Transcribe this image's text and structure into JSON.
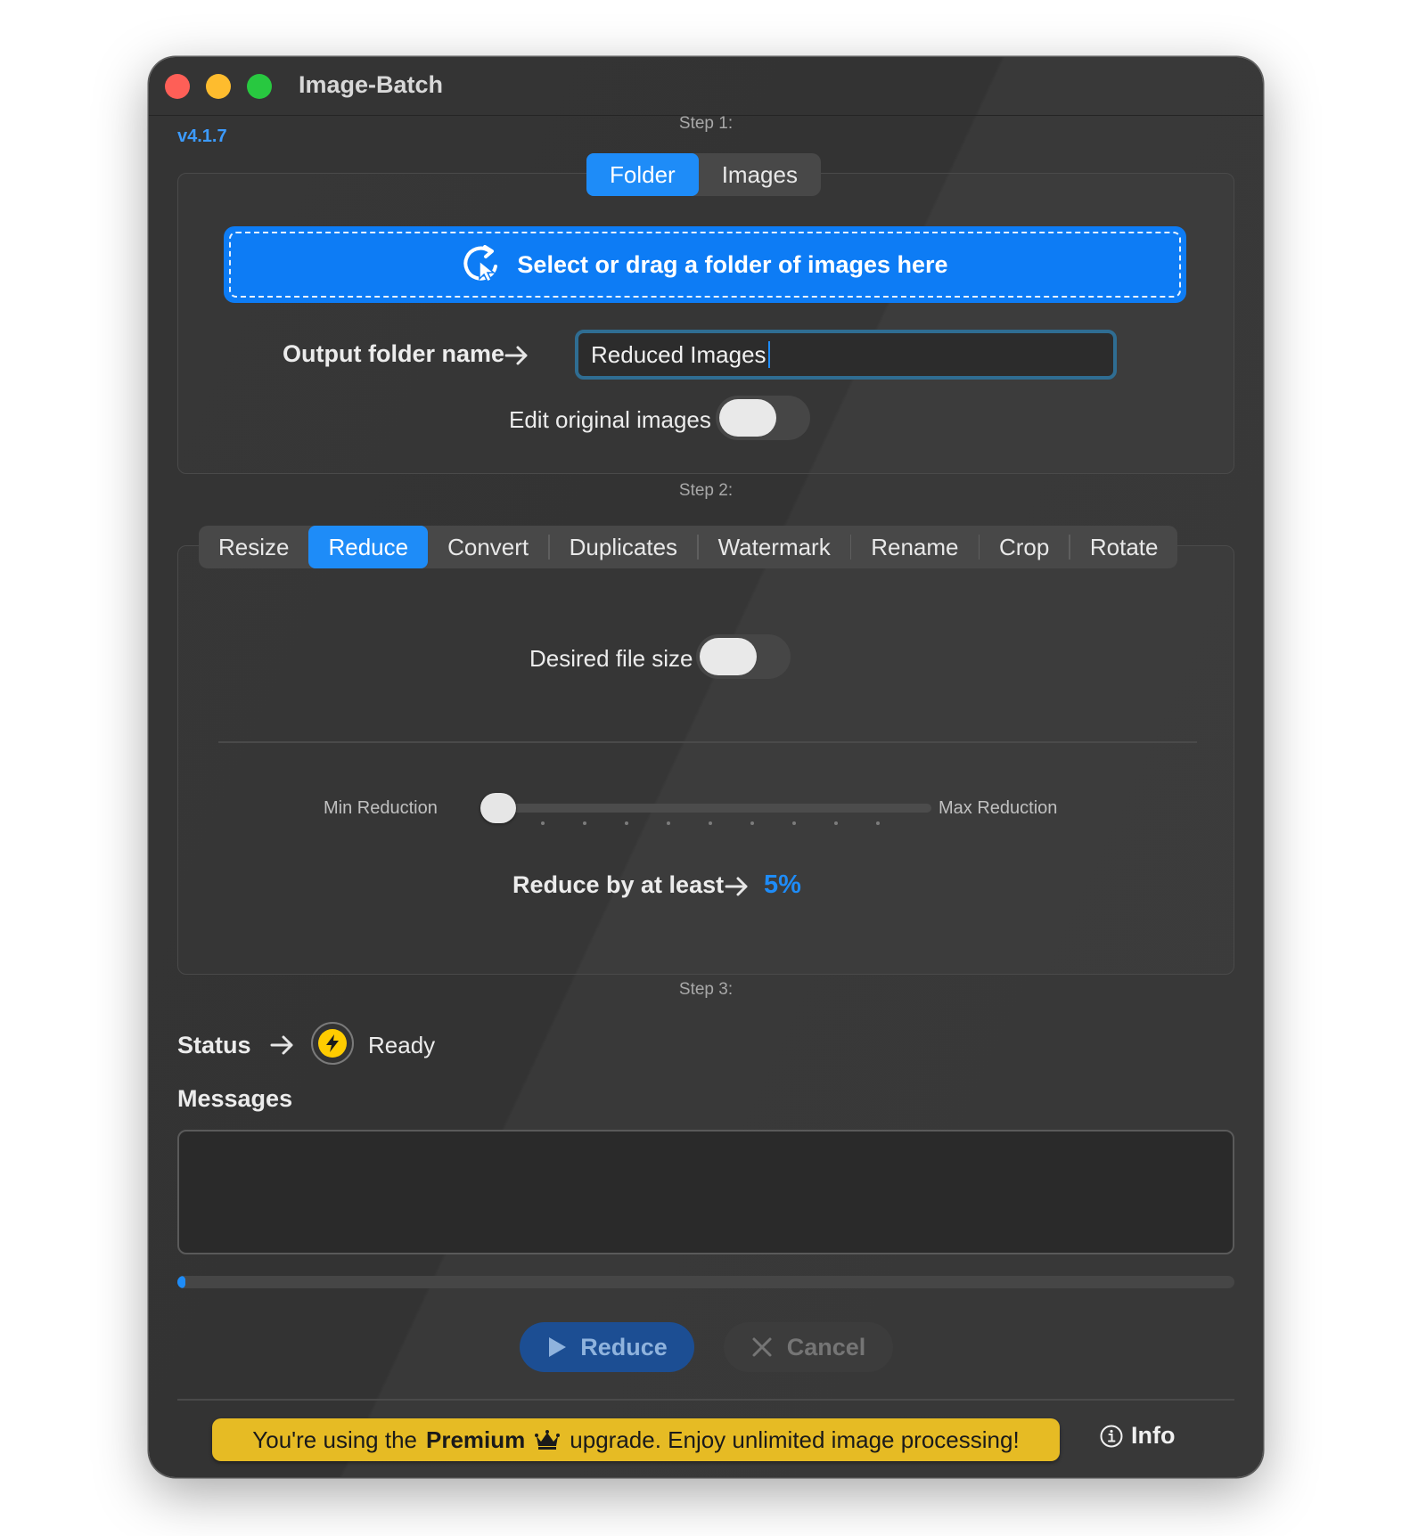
{
  "window": {
    "title": "Image-Batch",
    "version": "v4.1.7"
  },
  "step1": {
    "label": "Step 1:",
    "source_tabs": [
      {
        "label": "Folder",
        "selected": true
      },
      {
        "label": "Images",
        "selected": false
      }
    ],
    "dropzone_text": "Select or drag a folder of images here",
    "output_folder_label": "Output folder name",
    "output_folder_value": "Reduced Images",
    "edit_original_label": "Edit original images",
    "edit_original_on": false
  },
  "step2": {
    "label": "Step 2:",
    "tabs": [
      "Resize",
      "Reduce",
      "Convert",
      "Duplicates",
      "Watermark",
      "Rename",
      "Crop",
      "Rotate"
    ],
    "selected_tab": "Reduce",
    "desired_size_label": "Desired file size",
    "desired_size_on": false,
    "slider": {
      "min_label": "Min Reduction",
      "max_label": "Max Reduction",
      "value_fraction": 0,
      "tick_count": 9
    },
    "reduce_label": "Reduce by at least",
    "reduce_value": "5%"
  },
  "step3": {
    "label": "Step 3:",
    "status_label": "Status",
    "status_value": "Ready",
    "messages_label": "Messages",
    "messages_text": "",
    "progress_percent": 1
  },
  "actions": {
    "primary": "Reduce",
    "secondary": "Cancel"
  },
  "footer": {
    "banner_prefix": "You're using the",
    "banner_premium": "Premium",
    "banner_suffix": "upgrade. Enjoy unlimited image processing!",
    "info_label": "Info"
  },
  "colors": {
    "accent": "#1e8cf8",
    "banner": "#e6bb24",
    "status": "#ffcc00"
  }
}
